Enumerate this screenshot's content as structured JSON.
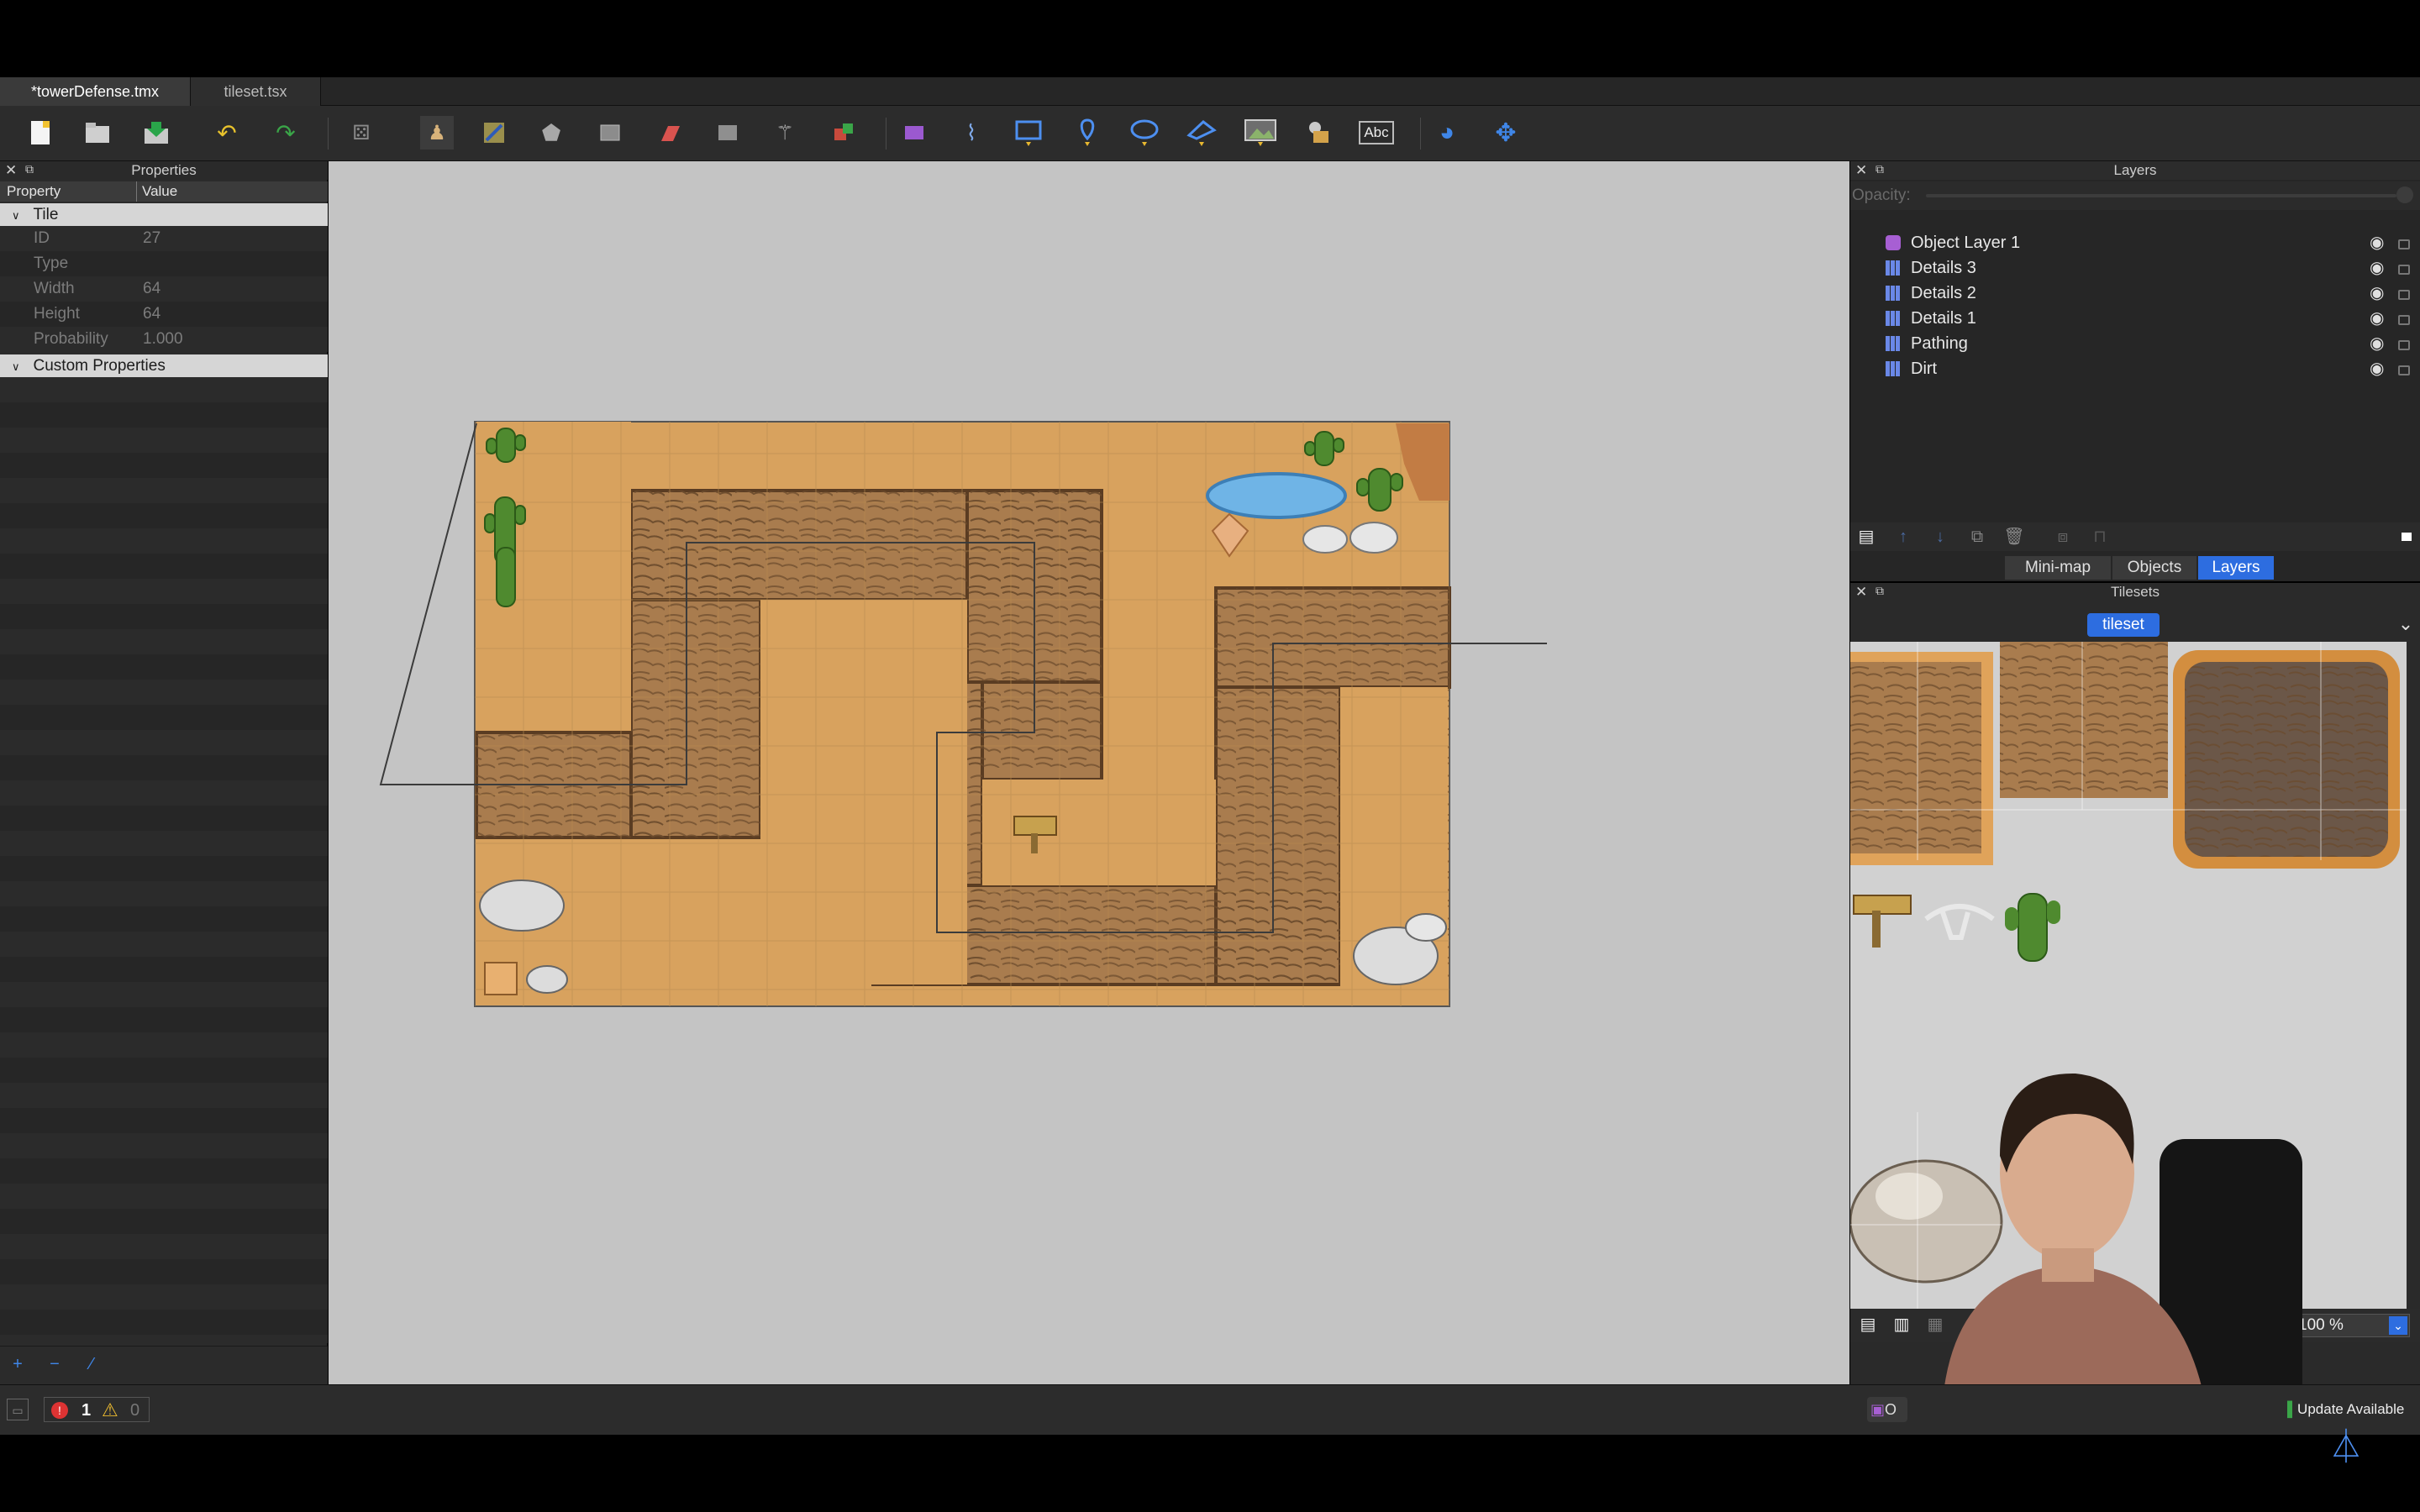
{
  "tabs": [
    {
      "label": "*towerDefense.tmx",
      "active": true
    },
    {
      "label": "tileset.tsx",
      "active": false
    }
  ],
  "toolbar": {
    "icons": [
      "new-map-icon",
      "open-file-icon",
      "save-file-icon",
      "undo-icon",
      "redo-icon",
      "random-mode-icon",
      "stamp-brush-icon",
      "terrain-brush-icon",
      "bucket-fill-icon",
      "shape-fill-icon",
      "eraser-icon",
      "rectangular-select-icon",
      "magic-wand-icon",
      "select-same-tile-icon",
      "select-objects-icon",
      "edit-polygons-icon",
      "insert-rectangle-icon",
      "insert-point-icon",
      "insert-ellipse-icon",
      "insert-polygon-icon",
      "insert-tile-icon",
      "insert-template-icon",
      "insert-text-icon",
      "world-tool-icon",
      "move-icon"
    ],
    "insert_text_label": "Abc"
  },
  "properties_panel": {
    "title": "Properties",
    "col_property": "Property",
    "col_value": "Value",
    "group_tile": "Tile",
    "rows": [
      {
        "name": "ID",
        "value": "27"
      },
      {
        "name": "Type",
        "value": ""
      },
      {
        "name": "Width",
        "value": "64"
      },
      {
        "name": "Height",
        "value": "64"
      },
      {
        "name": "Probability",
        "value": "1.000"
      }
    ],
    "group_custom": "Custom Properties"
  },
  "layers_panel": {
    "title": "Layers",
    "opacity_label": "Opacity:",
    "layers": [
      {
        "name": "Object Layer 1",
        "type": "object"
      },
      {
        "name": "Details 3",
        "type": "tile"
      },
      {
        "name": "Details 2",
        "type": "tile"
      },
      {
        "name": "Details 1",
        "type": "tile"
      },
      {
        "name": "Pathing",
        "type": "tile"
      },
      {
        "name": "Dirt",
        "type": "tile"
      }
    ],
    "tabs": [
      "Mini-map",
      "Objects",
      "Layers"
    ],
    "active_tab": "Layers"
  },
  "tilesets_panel": {
    "title": "Tilesets",
    "tileset_name": "tileset",
    "zoom": "100 %"
  },
  "status_bar": {
    "errors": "1",
    "warnings": "0",
    "update_label": "Update Available",
    "layer_badge": "O"
  },
  "colors": {
    "accent": "#2d6de0",
    "sand": "#d8a25e",
    "path": "#a97c4e",
    "canvas_bg": "#c4c4c4"
  }
}
